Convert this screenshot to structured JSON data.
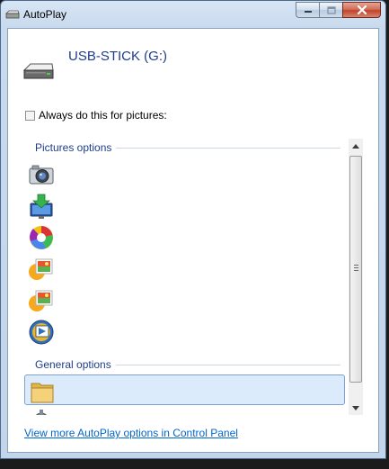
{
  "window": {
    "title": "AutoPlay",
    "app_icon": "drive-icon",
    "controls": {
      "minimize": "minimize-icon",
      "maximize": "maximize-icon",
      "close": "close-icon"
    }
  },
  "device": {
    "name": "USB-STICK (G:)",
    "icon": "usb-drive-icon"
  },
  "always_do": {
    "label": "Always do this for pictures:",
    "checked": false
  },
  "sections": [
    {
      "label": "Pictures options",
      "items": [
        {
          "icon": "camera-icon"
        },
        {
          "icon": "import-to-computer-icon"
        },
        {
          "icon": "picasa-icon"
        },
        {
          "icon": "photo-gallery-icon"
        },
        {
          "icon": "photo-gallery-icon"
        },
        {
          "icon": "media-player-icon"
        }
      ]
    },
    {
      "label": "General options",
      "items": [
        {
          "icon": "folder-icon",
          "selected": true
        },
        {
          "icon": "gear-icon"
        }
      ]
    }
  ],
  "footer": {
    "link": "View more AutoPlay options in Control Panel"
  },
  "colors": {
    "accent": "#1e3c8c",
    "link": "#0066cc",
    "selection": "#dcebfc"
  }
}
